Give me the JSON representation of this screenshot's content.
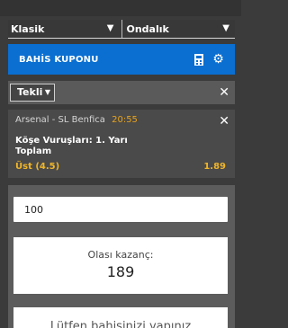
{
  "selects": {
    "format": "Klasik",
    "odds_format": "Ondalık"
  },
  "coupon": {
    "title": "BAHİS KUPONU"
  },
  "bet_type": {
    "selected": "Tekli"
  },
  "bet": {
    "match": "Arsenal - SL Benfica",
    "time": "20:55",
    "market": "Köşe Vuruşları: 1. Yarı Toplam",
    "selection": "Üst (4.5)",
    "odds": "1.89"
  },
  "stake": {
    "value": "100"
  },
  "winnings": {
    "label": "Olası kazanç:",
    "value": "189"
  },
  "footer": {
    "message": "Lütfen bahisinizi yapınız"
  }
}
